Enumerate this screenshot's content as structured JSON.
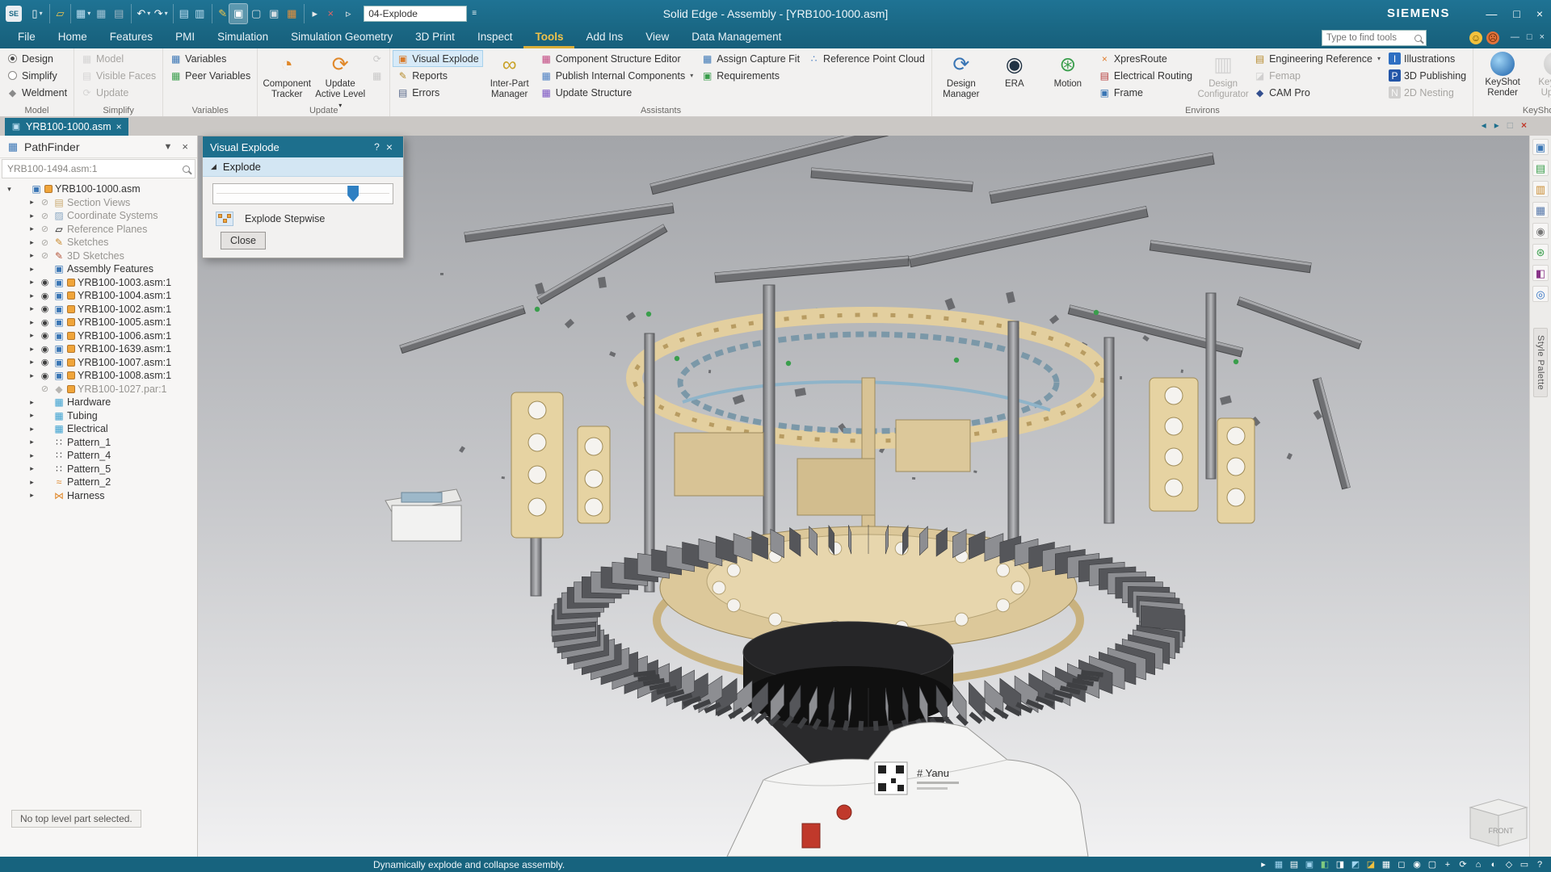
{
  "titlebar": {
    "app_logo": "SE",
    "title": "Solid Edge - Assembly - [YRB100-1000.asm]",
    "brand": "SIEMENS",
    "view_config": "04-Explode",
    "qat": [
      {
        "name": "new-button",
        "g": "▯",
        "c": "#ffffff",
        "cls": "caret"
      },
      {
        "name": "open-button",
        "g": "▱",
        "c": "#eec64f",
        "cls": "sep"
      },
      {
        "name": "save-button",
        "g": "▦",
        "c": "#bfe0f2",
        "cls": "sep caret"
      },
      {
        "name": "save-all-button",
        "g": "▦",
        "c": "#9fc2d4",
        "cls": ""
      },
      {
        "name": "print-button",
        "g": "▤",
        "c": "#9fb6c2",
        "cls": ""
      },
      {
        "name": "undo-button",
        "g": "↶",
        "c": "#ffffff",
        "cls": "sep caret"
      },
      {
        "name": "redo-button",
        "g": "↷",
        "c": "#ffffff",
        "cls": "caret"
      },
      {
        "name": "document-properties-button",
        "g": "▤",
        "c": "#bfe0f2",
        "cls": "sep"
      },
      {
        "name": "journal-button",
        "g": "▥",
        "c": "#bfe0f2",
        "cls": ""
      },
      {
        "name": "edit-properties-button",
        "g": "✎",
        "c": "#eec64f",
        "cls": "sep"
      },
      {
        "name": "display-configurations-button",
        "g": "▣",
        "c": "#ffffff",
        "cls": "active"
      },
      {
        "name": "hide-components-button",
        "g": "▢",
        "c": "#d5dde2",
        "cls": ""
      },
      {
        "name": "show-components-button",
        "g": "▣",
        "c": "#d5dde2",
        "cls": ""
      },
      {
        "name": "grid-options-button",
        "g": "▦",
        "c": "#e8913a",
        "cls": ""
      },
      {
        "name": "select-visible-button",
        "g": "▸",
        "c": "#e8e8e8",
        "cls": "sep"
      },
      {
        "name": "deselect-set-button",
        "g": "×",
        "c": "#e06666",
        "cls": ""
      },
      {
        "name": "select-prior-button",
        "g": "▹",
        "c": "#e8e8e8",
        "cls": ""
      }
    ]
  },
  "menu": {
    "tabs": [
      {
        "label": "File",
        "cls": ""
      },
      {
        "label": "Home",
        "cls": ""
      },
      {
        "label": "Features",
        "cls": ""
      },
      {
        "label": "PMI",
        "cls": ""
      },
      {
        "label": "Simulation",
        "cls": ""
      },
      {
        "label": "Simulation Geometry",
        "cls": ""
      },
      {
        "label": "3D Print",
        "cls": ""
      },
      {
        "label": "Inspect",
        "cls": ""
      },
      {
        "label": "Tools",
        "cls": "active"
      },
      {
        "label": "Add Ins",
        "cls": ""
      },
      {
        "label": "View",
        "cls": ""
      },
      {
        "label": "Data Management",
        "cls": ""
      }
    ],
    "find_placeholder": "Type to find tools"
  },
  "ribbon": {
    "model": {
      "label": "Model",
      "design": "Design",
      "simplify": "Simplify",
      "weldment": "Weldment"
    },
    "simplify_group": {
      "label": "Simplify",
      "model": "Model",
      "visible_faces": "Visible Faces",
      "update": "Update"
    },
    "variables": {
      "label": "Variables",
      "variables": "Variables",
      "peer_variables": "Peer Variables"
    },
    "update_group": {
      "label": "Update",
      "component_tracker": "Component Tracker",
      "update_active_level": "Update Active Level"
    },
    "assistants": {
      "label": "Assistants",
      "visual_explode": "Visual Explode",
      "reports": "Reports",
      "errors": "Errors",
      "inter_part_manager": "Inter-Part Manager",
      "component_structure_editor": "Component Structure Editor",
      "publish_internal_components": "Publish Internal Components",
      "update_structure": "Update Structure",
      "assign_capture_fit": "Assign Capture Fit",
      "requirements": "Requirements",
      "reference_point_cloud": "Reference Point Cloud"
    },
    "environs": {
      "label": "Environs",
      "design_manager": "Design Manager",
      "era": "ERA",
      "motion": "Motion",
      "xpresroute": "XpresRoute",
      "electrical_routing": "Electrical Routing",
      "frame": "Frame",
      "design_configurator": "Design Configurator",
      "engineering_reference": "Engineering Reference",
      "femap": "Femap",
      "cam_pro": "CAM Pro",
      "illustrations": "Illustrations",
      "publishing_3d": "3D Publishing",
      "nesting_2d": "2D Nesting"
    },
    "keyshot": {
      "label": "KeyShot",
      "render": "KeyShot Render",
      "update": "KeyShot Update"
    }
  },
  "tabbar": {
    "document_tab": "YRB100-1000.asm"
  },
  "pathfinder": {
    "title": "PathFinder",
    "locate_value": "YRB100-1494.asm:1",
    "note": "No top level part selected.",
    "tree": [
      {
        "label": "YRB100-1000.asm",
        "arrow": "▾",
        "eye": "",
        "ig": "▣",
        "ic": "#3a76b5",
        "cls": "badged"
      },
      {
        "label": "Section Views",
        "arrow": "▸",
        "eye": "⊘",
        "ig": "▤",
        "ic": "#c9a96f",
        "cls": "lvl1 dim"
      },
      {
        "label": "Coordinate Systems",
        "arrow": "▸",
        "eye": "⊘",
        "ig": "▨",
        "ic": "#8aa7c2",
        "cls": "lvl1 dim"
      },
      {
        "label": "Reference Planes",
        "arrow": "▸",
        "eye": "⊘",
        "ig": "▱",
        "ic": "#9a9археo",
        " cls": "lvl1 dim",
        "ic2": "#9a9896",
        "cls": "lvl1 dim"
      },
      {
        "label": "Sketches",
        "arrow": "▸",
        "eye": "⊘",
        "ig": "✎",
        "ic": "#c98a2e",
        "cls": "lvl1 dim"
      },
      {
        "label": "3D Sketches",
        "arrow": "▸",
        "eye": "⊘",
        "ig": "✎",
        "ic": "#b5543a",
        "cls": "lvl1 dim"
      },
      {
        "label": "Assembly Features",
        "arrow": "▸",
        "eye": "",
        "ig": "▣",
        "ic": "#3a76b5",
        "cls": "lvl1"
      },
      {
        "label": "YRB100-1003.asm:1",
        "arrow": "▸",
        "eye": "◉",
        "ig": "▣",
        "ic": "#3a76b5",
        "cls": "lvl1 badged"
      },
      {
        "label": "YRB100-1004.asm:1",
        "arrow": "▸",
        "eye": "◉",
        "ig": "▣",
        "ic": "#3a76b5",
        "cls": "lvl1 badged"
      },
      {
        "label": "YRB100-1002.asm:1",
        "arrow": "▸",
        "eye": "◉",
        "ig": "▣",
        "ic": "#3a76b5",
        "cls": "lvl1 badged"
      },
      {
        "label": "YRB100-1005.asm:1",
        "arrow": "▸",
        "eye": "◉",
        "ig": "▣",
        "ic": "#3a76b5",
        "cls": "lvl1 badged"
      },
      {
        "label": "YRB100-1006.asm:1",
        "arrow": "▸",
        "eye": "◉",
        "ig": "▣",
        "ic": "#3a76b5",
        "cls": "lvl1 badged"
      },
      {
        "label": "YRB100-1639.asm:1",
        "arrow": "▸",
        "eye": "◉",
        "ig": "▣",
        "ic": "#3a76b5",
        "cls": "lvl1 badged"
      },
      {
        "label": "YRB100-1007.asm:1",
        "arrow": "▸",
        "eye": "◉",
        "ig": "▣",
        "ic": "#3a76b5",
        "cls": "lvl1 badged"
      },
      {
        "label": "YRB100-1008.asm:1",
        "arrow": "▸",
        "eye": "◉",
        "ig": "▣",
        "ic": "#3a76b5",
        "cls": "lvl1 badged"
      },
      {
        "label": "YRB100-1027.par:1",
        "arrow": "",
        "eye": "⊘",
        "ig": "◆",
        "ic": "#b8b6b2",
        "cls": "lvl1 dim badged"
      },
      {
        "label": "Hardware",
        "arrow": "▸",
        "eye": "",
        "ig": "▦",
        "ic": "#39a0d0",
        "cls": "lvl1"
      },
      {
        "label": "Tubing",
        "arrow": "▸",
        "eye": "",
        "ig": "▦",
        "ic": "#39a0d0",
        "cls": "lvl1"
      },
      {
        "label": "Electrical",
        "arrow": "▸",
        "eye": "",
        "ig": "▦",
        "ic": "#39a0d0",
        "cls": "lvl1"
      },
      {
        "label": "Pattern_1",
        "arrow": "▸",
        "eye": "",
        "ig": "∷",
        "ic": "#4a4a4a",
        "cls": "lvl1"
      },
      {
        "label": "Pattern_4",
        "arrow": "▸",
        "eye": "",
        "ig": "∷",
        "ic": "#4a4a4a",
        "cls": "lvl1"
      },
      {
        "label": "Pattern_5",
        "arrow": "▸",
        "eye": "",
        "ig": "∷",
        "ic": "#4a4a4a",
        "cls": "lvl1"
      },
      {
        "label": "Pattern_2",
        "arrow": "▸",
        "eye": "",
        "ig": "≈",
        "ic": "#e0882a",
        "cls": "lvl1"
      },
      {
        "label": "Harness",
        "arrow": "▸",
        "eye": "",
        "ig": "⋈",
        "ic": "#e0882a",
        "cls": "lvl1"
      }
    ]
  },
  "dialog": {
    "title": "Visual Explode",
    "help": "?",
    "section": "Explode",
    "slider_percent": 78,
    "explode_stepwise": "Explode Stepwise",
    "close": "Close"
  },
  "viewport": {
    "front_cube_label": "FRONT",
    "marking_text": "# Yanu"
  },
  "right_toolbar": {
    "style_palette_label": "Style Palette",
    "icons": [
      {
        "name": "quick-view-cube-icon",
        "g": "▣",
        "c": "#3a76b5"
      },
      {
        "name": "pathfinder-tab-icon",
        "g": "▤",
        "c": "#3a9e4c"
      },
      {
        "name": "library-tab-icon",
        "g": "▥",
        "c": "#c98a2e"
      },
      {
        "name": "layers-tab-icon",
        "g": "▦",
        "c": "#5577aa"
      },
      {
        "name": "sensors-tab-icon",
        "g": "◉",
        "c": "#777777"
      },
      {
        "name": "simulate-tab-icon",
        "g": "⊛",
        "c": "#3a9e4c"
      },
      {
        "name": "selection-sets-tab-icon",
        "g": "◧",
        "c": "#883388"
      },
      {
        "name": "web-browser-tab-icon",
        "g": "◎",
        "c": "#2e6fc2"
      }
    ]
  },
  "statusbar": {
    "message": "Dynamically explode and collapse assembly.",
    "tray": [
      {
        "name": "select-arrow-icon",
        "g": "▸",
        "c": "#ffffff"
      },
      {
        "name": "sketch-display-icon",
        "g": "▦",
        "c": "#9fd4ef"
      },
      {
        "name": "dimensions-display-icon",
        "g": "▤",
        "c": "#ffffff"
      },
      {
        "name": "pmi-display-icon",
        "g": "▣",
        "c": "#9fd4ef"
      },
      {
        "name": "construction-display-icon",
        "g": "◧",
        "c": "#7fc97f"
      },
      {
        "name": "coordinate-display-icon",
        "g": "◨",
        "c": "#ffffff"
      },
      {
        "name": "planes-display-icon",
        "g": "◩",
        "c": "#9fd4ef"
      },
      {
        "name": "sketches-display-icon",
        "g": "◪",
        "c": "#f0c040"
      },
      {
        "name": "all-display-icon",
        "g": "▦",
        "c": "#ffffff"
      },
      {
        "name": "zoom-area-icon",
        "g": "◻",
        "c": "#ffffff"
      },
      {
        "name": "zoom-icon",
        "g": "◉",
        "c": "#ffffff"
      },
      {
        "name": "fit-icon",
        "g": "▢",
        "c": "#ffffff"
      },
      {
        "name": "pan-icon",
        "g": "+",
        "c": "#ffffff"
      },
      {
        "name": "rotate-icon",
        "g": "⟳",
        "c": "#ffffff"
      },
      {
        "name": "named-views-icon",
        "g": "⌂",
        "c": "#ffffff"
      },
      {
        "name": "view-styles-icon",
        "g": "◐",
        "c": "#ffffff"
      },
      {
        "name": "perspective-icon",
        "g": "◇",
        "c": "#ffffff"
      },
      {
        "name": "screen-layout-icon",
        "g": "▭",
        "c": "#ffffff"
      },
      {
        "name": "help-icon",
        "g": "?",
        "c": "#ffffff"
      }
    ]
  },
  "icons": {
    "weldment-icon": {
      "g": "◆",
      "c": "#8a8a8a"
    },
    "model-disabled-icon": {
      "g": "▦",
      "c": "#b5b3b0"
    },
    "visible-faces-icon": {
      "g": "▤",
      "c": "#b5b3b0"
    },
    "update-disabled-icon": {
      "g": "⟳",
      "c": "#b5b3b0"
    },
    "variables-icon": {
      "g": "▦",
      "c": "#3a76b5"
    },
    "peer-variables-icon": {
      "g": "▦",
      "c": "#3a9e4c"
    },
    "component-tracker-icon": {
      "g": "◔",
      "c": "#e0882a"
    },
    "update-active-level-icon": {
      "g": "⟳",
      "c": "#e0882a"
    },
    "update-all-icon": {
      "g": "⟳",
      "c": "#9a9896"
    },
    "refresh-structure-icon": {
      "g": "▦",
      "c": "#9a9896"
    },
    "visual-explode-icon": {
      "g": "▣",
      "c": "#d97b2a"
    },
    "reports-icon": {
      "g": "✎",
      "c": "#b58a2a"
    },
    "errors-icon": {
      "g": "▤",
      "c": "#556688"
    },
    "inter-part-manager-icon": {
      "g": "∞",
      "c": "#c9a227"
    },
    "component-structure-editor-icon": {
      "g": "▦",
      "c": "#c2457f"
    },
    "publish-internal-components-icon": {
      "g": "▦",
      "c": "#4a7ec2"
    },
    "update-structure-icon": {
      "g": "▦",
      "c": "#7a52c2"
    },
    "assign-capture-fit-icon": {
      "g": "▦",
      "c": "#3a76b5"
    },
    "requirements-icon": {
      "g": "▣",
      "c": "#3a9e4c"
    },
    "reference-point-cloud-icon": {
      "g": "∴",
      "c": "#4a7ec2"
    },
    "design-manager-icon": {
      "g": "⟳",
      "c": "#3a76b5"
    },
    "era-icon": {
      "g": "◉",
      "c": "#223344"
    },
    "motion-icon": {
      "g": "⊛",
      "c": "#3a9e4c"
    },
    "xpresroute-icon": {
      "g": "×",
      "c": "#e07b2a"
    },
    "electrical-routing-icon": {
      "g": "▤",
      "c": "#b53a3a"
    },
    "frame-icon": {
      "g": "▣",
      "c": "#3a76b5"
    },
    "design-configurator-icon": {
      "g": "▥",
      "c": "#b5b3b0"
    },
    "engineering-reference-icon": {
      "g": "▤",
      "c": "#b5892a"
    },
    "femap-icon": {
      "g": "◪",
      "c": "#aaaaaa"
    },
    "cam-pro-icon": {
      "g": "◆",
      "c": "#334f8f"
    },
    "illustrations-icon": {
      "g": "I",
      "c": "#ffffff",
      "b": "#2e6fc2"
    },
    "publishing-3d-icon": {
      "g": "P",
      "c": "#ffffff",
      "b": "#2456a8"
    },
    "nesting-2d-icon": {
      "g": "N",
      "c": "#ffffff",
      "b": "#a9a7a4"
    },
    "keyshot-render-icon": {
      "g": "",
      "b": "radial-gradient(circle at 35% 35%, #9fd4f5, #1b5fa8)"
    },
    "keyshot-update-icon": {
      "g": "",
      "b": "radial-gradient(circle at 35% 35%, #d5d5d5, #8a8a8a)"
    },
    "keyshot-settings-icon": {
      "g": "◉",
      "c": "#3a76b5"
    },
    "document-icon": {
      "g": "▣",
      "c": "#bfe0f2"
    },
    "pathfinder-icon": {
      "g": "▦",
      "c": "#3a76b5"
    },
    "display-options-icon": {
      "g": "▼",
      "c": "#555555"
    },
    "close-icon": {
      "g": "×",
      "c": ""
    },
    "help-icon": {
      "g": "?",
      "c": ""
    },
    "minimize-icon": {
      "g": "—",
      "c": ""
    },
    "restore-icon": {
      "g": "□",
      "c": ""
    },
    "tri-collapse-icon": {
      "g": "◢",
      "c": "#333333"
    },
    "nav-back-icon": {
      "g": "◂",
      "c": ""
    },
    "nav-forward-icon": {
      "g": "▸",
      "c": ""
    },
    "qat-customize-icon": {
      "g": "▾",
      "c": "#ffffff"
    },
    "ribbon-collapse-icon": {
      "g": "≡",
      "c": "#ffffff"
    }
  }
}
